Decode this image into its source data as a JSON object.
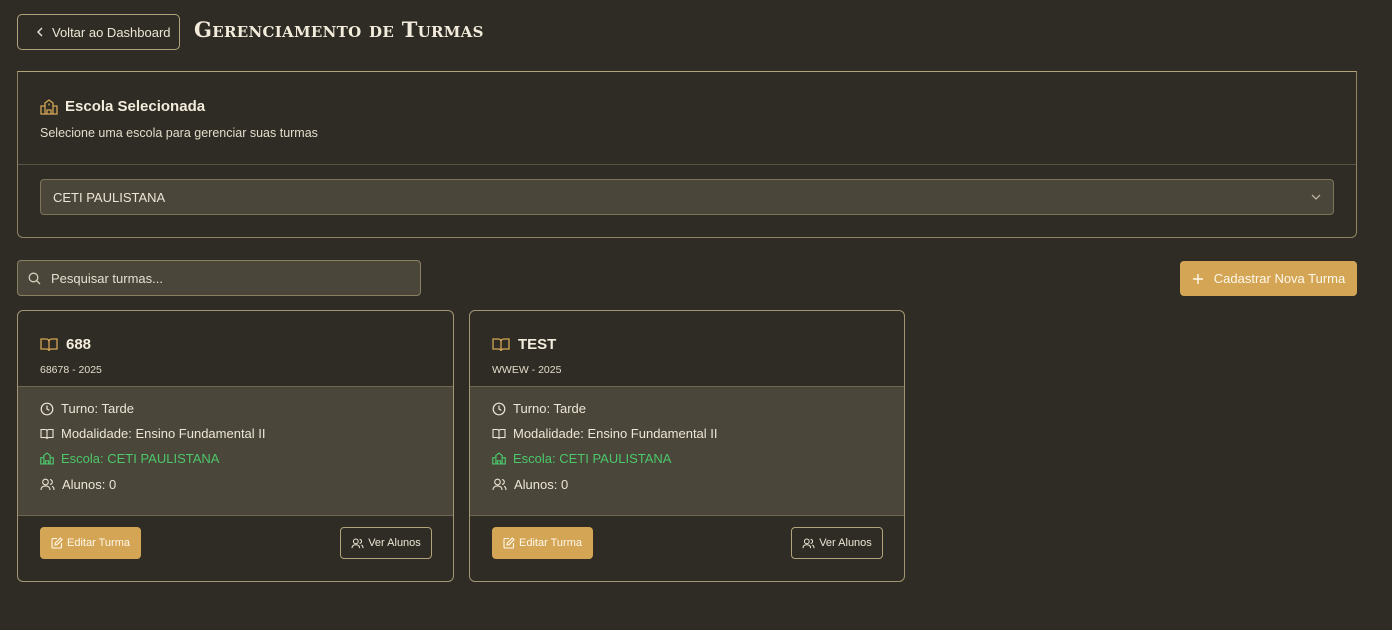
{
  "header": {
    "back_label": "Voltar ao Dashboard",
    "title": "Gerenciamento de Turmas"
  },
  "school": {
    "title": "Escola Selecionada",
    "subtitle": "Selecione uma escola para gerenciar suas turmas",
    "selected": "CETI PAULISTANA"
  },
  "search": {
    "placeholder": "Pesquisar turmas..."
  },
  "add_button": "Cadastrar Nova Turma",
  "classes": [
    {
      "name": "688",
      "code": "68678 - 2025",
      "turno": "Turno: Tarde",
      "modalidade": "Modalidade: Ensino Fundamental II",
      "escola": "Escola: CETI PAULISTANA",
      "alunos": "Alunos: 0",
      "edit_label": "Editar Turma",
      "view_label": "Ver Alunos"
    },
    {
      "name": "TEST",
      "code": "WWEW - 2025",
      "turno": "Turno: Tarde",
      "modalidade": "Modalidade: Ensino Fundamental II",
      "escola": "Escola: CETI PAULISTANA",
      "alunos": "Alunos: 0",
      "edit_label": "Editar Turma",
      "view_label": "Ver Alunos"
    }
  ],
  "colors": {
    "background": "#2f2c25",
    "accent": "#d4a555",
    "success": "#4cc76a",
    "panel": "#4a463a"
  }
}
